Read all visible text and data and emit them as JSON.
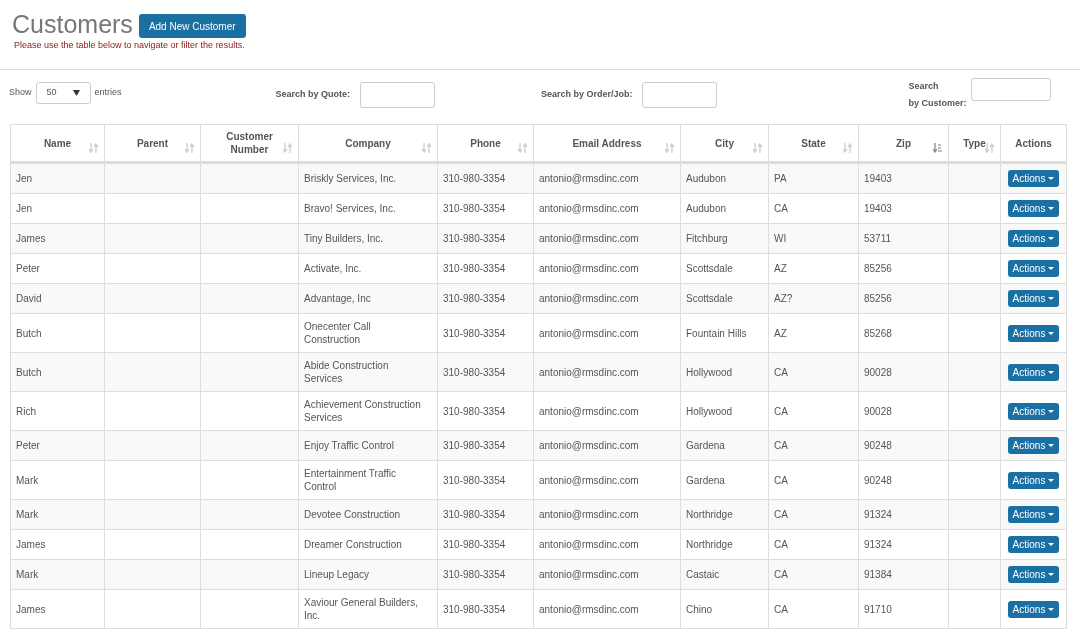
{
  "header": {
    "title": "Customers",
    "add_button": "Add New Customer",
    "subtitle": "Please use the table below to navigate or filter the results."
  },
  "filters": {
    "show_label": "Show",
    "entries_value": "50",
    "entries_label": "entries",
    "quote_label": "Search by Quote:",
    "order_label": "Search by Order/Job:",
    "customer_label_1": "Search",
    "customer_label_2": "by Customer:"
  },
  "table": {
    "columns": [
      {
        "label": "Name",
        "sortable": true,
        "sorted": false
      },
      {
        "label": "Parent",
        "sortable": true,
        "sorted": false
      },
      {
        "label": "Customer Number",
        "sortable": true,
        "sorted": false
      },
      {
        "label": "Company",
        "sortable": true,
        "sorted": false
      },
      {
        "label": "Phone",
        "sortable": true,
        "sorted": false
      },
      {
        "label": "Email Address",
        "sortable": true,
        "sorted": false
      },
      {
        "label": "City",
        "sortable": true,
        "sorted": false
      },
      {
        "label": "State",
        "sortable": true,
        "sorted": false
      },
      {
        "label": "Zip",
        "sortable": true,
        "sorted": true
      },
      {
        "label": "Type",
        "sortable": true,
        "sorted": false
      },
      {
        "label": "Actions",
        "sortable": false
      }
    ],
    "rows": [
      {
        "name": "Jen",
        "company": "Briskly Services, Inc.",
        "phone": "310-980-3354",
        "email": "antonio@rmsdinc.com",
        "city": "Audubon",
        "state": "PA",
        "zip": "19403",
        "action": "Actions"
      },
      {
        "name": "Jen",
        "company": "Bravo! Services, Inc.",
        "phone": "310-980-3354",
        "email": "antonio@rmsdinc.com",
        "city": "Audubon",
        "state": "CA",
        "zip": "19403",
        "action": "Actions"
      },
      {
        "name": "James",
        "company": "Tiny Builders, Inc.",
        "phone": "310-980-3354",
        "email": "antonio@rmsdinc.com",
        "city": "Fitchburg",
        "state": "WI",
        "zip": "53711",
        "action": "Actions"
      },
      {
        "name": "Peter",
        "company": "Activate, Inc.",
        "phone": "310-980-3354",
        "email": "antonio@rmsdinc.com",
        "city": "Scottsdale",
        "state": "AZ",
        "zip": "85256",
        "action": "Actions"
      },
      {
        "name": "David",
        "company": "Advantage, Inc",
        "phone": "310-980-3354",
        "email": "antonio@rmsdinc.com",
        "city": "Scottsdale",
        "state": "AZ?",
        "zip": "85256",
        "action": "Actions"
      },
      {
        "name": "Butch",
        "company": "Onecenter Call Construction",
        "phone": "310-980-3354",
        "email": "antonio@rmsdinc.com",
        "city": "Fountain Hills",
        "state": "AZ",
        "zip": "85268",
        "action": "Actions"
      },
      {
        "name": "Butch",
        "company": "Abide Construction Services",
        "phone": "310-980-3354",
        "email": "antonio@rmsdinc.com",
        "city": "Hollywood",
        "state": "CA",
        "zip": "90028",
        "action": "Actions"
      },
      {
        "name": "Rich",
        "company": "Achievement Construction Services",
        "phone": "310-980-3354",
        "email": "antonio@rmsdinc.com",
        "city": "Hollywood",
        "state": "CA",
        "zip": "90028",
        "action": "Actions"
      },
      {
        "name": "Peter",
        "company": "Enjoy Traffic Control",
        "phone": "310-980-3354",
        "email": "antonio@rmsdinc.com",
        "city": "Gardena",
        "state": "CA",
        "zip": "90248",
        "action": "Actions"
      },
      {
        "name": "Mark",
        "company": "Entertainment Traffic Control",
        "phone": "310-980-3354",
        "email": "antonio@rmsdinc.com",
        "city": "Gardena",
        "state": "CA",
        "zip": "90248",
        "action": "Actions"
      },
      {
        "name": "Mark",
        "company": "Devotee Construction",
        "phone": "310-980-3354",
        "email": "antonio@rmsdinc.com",
        "city": "Northridge",
        "state": "CA",
        "zip": "91324",
        "action": "Actions"
      },
      {
        "name": "James",
        "company": "Dreamer Construction",
        "phone": "310-980-3354",
        "email": "antonio@rmsdinc.com",
        "city": "Northridge",
        "state": "CA",
        "zip": "91324",
        "action": "Actions"
      },
      {
        "name": "Mark",
        "company": "Lineup Legacy",
        "phone": "310-980-3354",
        "email": "antonio@rmsdinc.com",
        "city": "Castaic",
        "state": "CA",
        "zip": "91384",
        "action": "Actions"
      },
      {
        "name": "James",
        "company": "Xaviour General Builders, Inc.",
        "phone": "310-980-3354",
        "email": "antonio@rmsdinc.com",
        "city": "Chino",
        "state": "CA",
        "zip": "91710",
        "action": "Actions"
      }
    ]
  }
}
